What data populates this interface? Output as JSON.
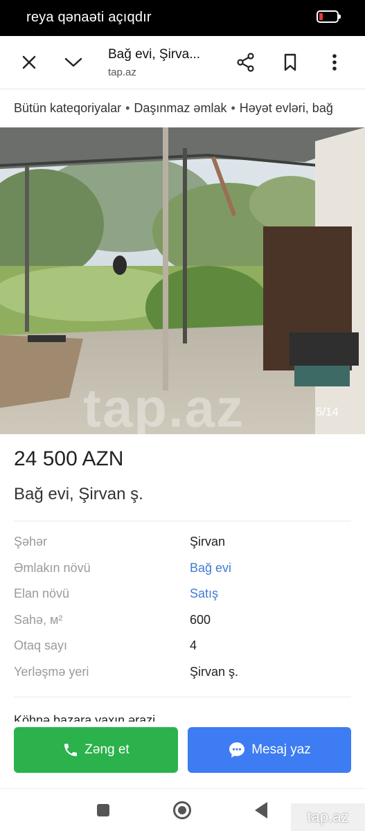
{
  "status_bar": {
    "text": "reya qənaəti açıqdır",
    "battery_icon": "battery-low-icon"
  },
  "browser": {
    "title": "Bağ evi, Şirva...",
    "url": "tap.az",
    "icons": [
      "close-icon",
      "chevron-down-icon",
      "share-icon",
      "bookmark-icon",
      "more-vertical-icon"
    ]
  },
  "breadcrumb": {
    "items": [
      "Bütün kateqoriyalar",
      "Daşınmaz əmlak",
      "Həyət evləri, bağ"
    ],
    "separator": "•"
  },
  "gallery": {
    "counter": "5/14",
    "watermark": "tap.az"
  },
  "listing": {
    "price": "24 500 AZN",
    "title": "Bağ evi, Şirvan ş."
  },
  "properties": [
    {
      "label": "Şəhər",
      "value": "Şirvan"
    },
    {
      "label": "Əmlakın növü",
      "value": "Bağ evi"
    },
    {
      "label": "Elan növü",
      "value": "Satış"
    },
    {
      "label": "Sahə, м²",
      "value": "600"
    },
    {
      "label": "Otaq sayı",
      "value": "4"
    },
    {
      "label": "Yerləşmə yeri",
      "value": "Şirvan ş."
    }
  ],
  "description": "Köhnə bazara yaxın ərazi",
  "actions": {
    "call_label": "Zəng et",
    "message_label": "Mesaj yaz"
  },
  "colors": {
    "call_button": "#2bb24c",
    "message_button": "#3d7cf2",
    "link": "#3e7bd6"
  },
  "nav": {
    "icons": [
      "recents-icon",
      "home-icon",
      "back-icon"
    ]
  },
  "corner_watermark": "tap.az"
}
